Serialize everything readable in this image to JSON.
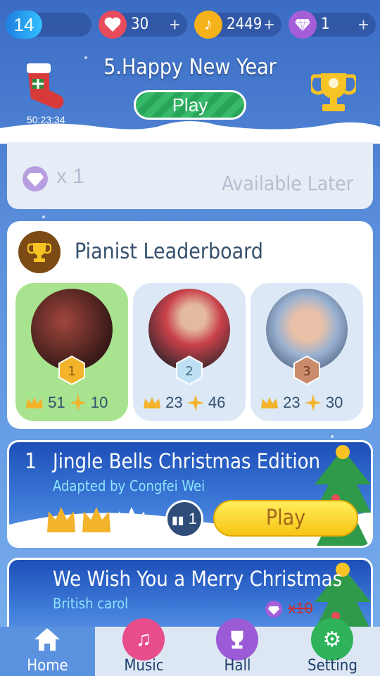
{
  "status_bar": {
    "level": "14",
    "hearts": "30",
    "notes": "2449",
    "gems": "1",
    "plus": "+"
  },
  "event": {
    "title": "5.Happy New Year",
    "play_label": "Play",
    "timer": "50:23:34"
  },
  "reward": {
    "count": "x 1",
    "status": "Available Later"
  },
  "leaderboard": {
    "title": "Pianist Leaderboard",
    "entries": [
      {
        "rank": "1",
        "crowns": "51",
        "stars": "10"
      },
      {
        "rank": "2",
        "crowns": "23",
        "stars": "46"
      },
      {
        "rank": "3",
        "crowns": "23",
        "stars": "30"
      }
    ]
  },
  "songs": [
    {
      "number": "1",
      "title": "Jingle Bells Christmas Edition",
      "subtitle": "Adapted by Congfei Wei",
      "rank_value": "1",
      "play_label": "Play"
    },
    {
      "title": "We Wish You a Merry Christmas",
      "subtitle": "British carol",
      "price": "10",
      "price_prefix": "x"
    }
  ],
  "nav": {
    "home": "Home",
    "music": "Music",
    "hall": "Hall",
    "setting": "Setting"
  },
  "colors": {
    "accent_blue": "#3a6cc4",
    "play_green": "#29a55a",
    "play_yellow": "#f6c515",
    "heart_red": "#e84c5c",
    "note_gold": "#f6b21a",
    "gem_purple": "#a45fd8",
    "first_place_green": "#a8e48f"
  }
}
